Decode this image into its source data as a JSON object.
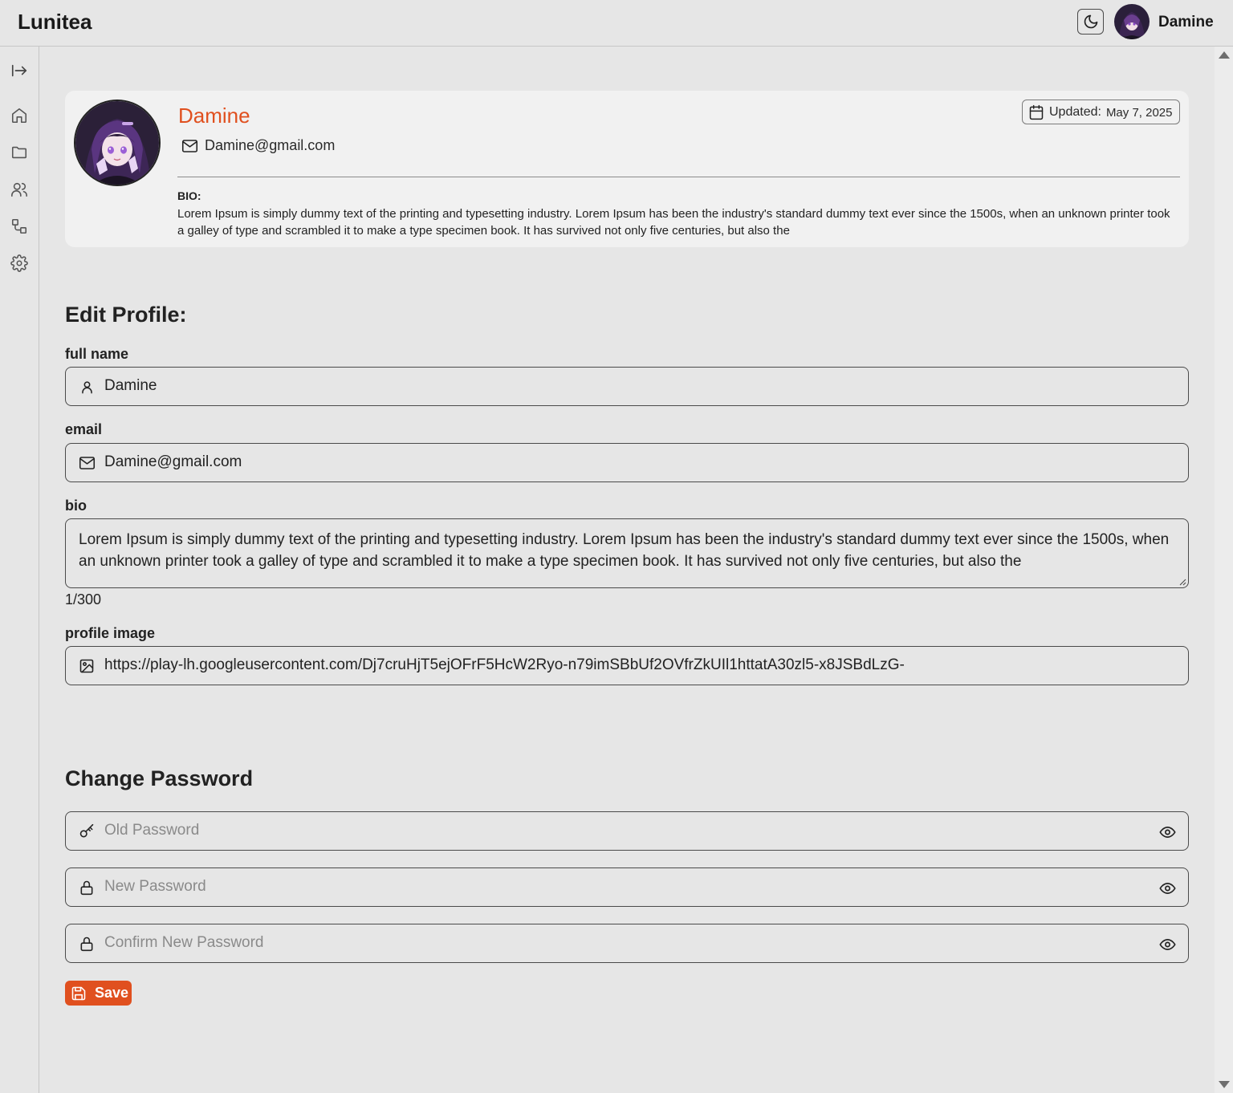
{
  "app": {
    "title": "Lunitea"
  },
  "header": {
    "user_name": "Damine",
    "theme_toggle_icon": "moon-icon"
  },
  "sidebar": {
    "items": [
      {
        "icon": "collapse-sidebar-icon"
      },
      {
        "icon": "home-icon"
      },
      {
        "icon": "folder-icon"
      },
      {
        "icon": "users-icon"
      },
      {
        "icon": "workflow-icon"
      },
      {
        "icon": "gear-icon"
      }
    ]
  },
  "profile_card": {
    "name": "Damine",
    "email": "Damine@gmail.com",
    "updated_label": "Updated:",
    "updated_date": "May 7, 2025",
    "bio_label": "BIO:",
    "bio": "Lorem Ipsum is simply dummy text of the printing and typesetting industry. Lorem Ipsum has been the industry's standard dummy text ever since the 1500s, when an unknown printer took a galley of type and scrambled it to make a type specimen book. It has survived not only five centuries, but also the"
  },
  "edit_profile": {
    "heading": "Edit Profile:",
    "full_name_label": "full name",
    "full_name_value": "Damine",
    "email_label": "email",
    "email_value": "Damine@gmail.com",
    "bio_label": "bio",
    "bio_value": "Lorem Ipsum is simply dummy text of the printing and typesetting industry. Lorem Ipsum has been the industry's standard dummy text ever since the 1500s, when an unknown printer took a galley of type and scrambled it to make a type specimen book. It has survived not only five centuries, but also the",
    "bio_counter": "1/300",
    "profile_image_label": "profile image",
    "profile_image_value": "https://play-lh.googleusercontent.com/Dj7cruHjT5ejOFrF5HcW2Ryo-n79imSBbUf2OVfrZkUIl1httatA30zl5-x8JSBdLzG-"
  },
  "change_password": {
    "heading": "Change Password",
    "old_placeholder": "Old Password",
    "new_placeholder": "New Password",
    "confirm_placeholder": "Confirm New Password",
    "save_label": "Save"
  },
  "colors": {
    "accent": "#e0501f",
    "background": "#e6e6e6",
    "card": "#f1f1f1"
  }
}
